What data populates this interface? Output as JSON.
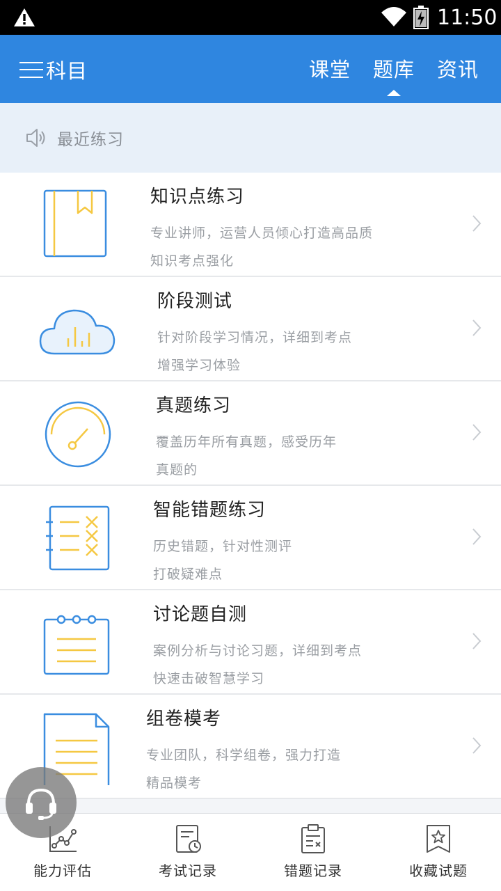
{
  "status_bar": {
    "time": "11:50"
  },
  "header": {
    "menu_label": "科目",
    "tabs": [
      {
        "label": "课堂"
      },
      {
        "label": "题库"
      },
      {
        "label": "资讯"
      }
    ]
  },
  "recent": {
    "label": "最近练习"
  },
  "items": [
    {
      "title": "知识点练习",
      "desc1": "专业讲师，运营人员倾心打造高品质",
      "desc2": "知识考点强化",
      "icon": "book-icon"
    },
    {
      "title": "阶段测试",
      "desc1": "针对阶段学习情况，详细到考点",
      "desc2": "增强学习体验",
      "icon": "cloud-chart-icon"
    },
    {
      "title": "真题练习",
      "desc1": "覆盖历年所有真题，感受历年",
      "desc2": "真题的",
      "icon": "gauge-icon"
    },
    {
      "title": "智能错题练习",
      "desc1": "历史错题，针对性测评",
      "desc2": "打破疑难点",
      "icon": "wrong-list-icon"
    },
    {
      "title": "讨论题自测",
      "desc1": "案例分析与讨论习题，详细到考点",
      "desc2": "快速击破智慧学习",
      "icon": "notepad-icon"
    },
    {
      "title": "组卷模考",
      "desc1": "专业团队，科学组卷，强力打造",
      "desc2": "精品模考",
      "icon": "document-icon"
    }
  ],
  "bottom_nav": [
    {
      "label": "能力评估",
      "icon": "chart-line-icon"
    },
    {
      "label": "考试记录",
      "icon": "exam-record-icon"
    },
    {
      "label": "错题记录",
      "icon": "wrong-record-icon"
    },
    {
      "label": "收藏试题",
      "icon": "favorite-icon"
    }
  ],
  "colors": {
    "primary": "#2f86e0",
    "icon_blue": "#3a8de0",
    "icon_yellow": "#f5c842",
    "recent_bg": "#e8f0f9"
  }
}
